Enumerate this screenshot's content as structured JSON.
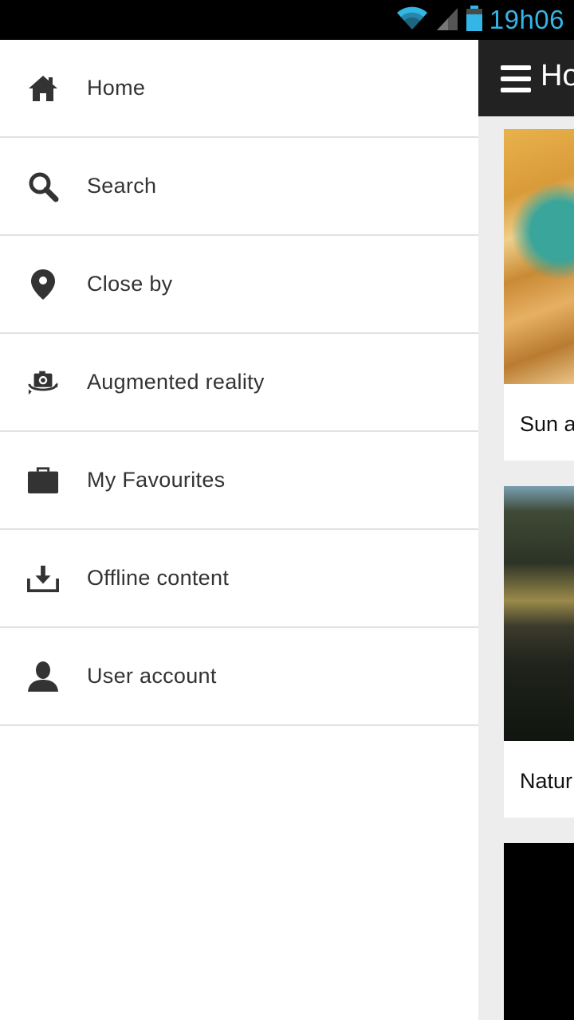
{
  "status_bar": {
    "time": "19h06",
    "icons": [
      "wifi-icon",
      "signal-icon",
      "battery-icon"
    ],
    "accent_color": "#33b5e5"
  },
  "drawer": {
    "items": [
      {
        "label": "Home",
        "icon": "home-icon"
      },
      {
        "label": "Search",
        "icon": "search-icon"
      },
      {
        "label": "Close by",
        "icon": "location-pin-icon"
      },
      {
        "label": "Augmented reality",
        "icon": "ar-camera-icon"
      },
      {
        "label": "My Favourites",
        "icon": "briefcase-icon"
      },
      {
        "label": "Offline content",
        "icon": "download-icon"
      },
      {
        "label": "User account",
        "icon": "user-icon"
      }
    ]
  },
  "app": {
    "title": "Ho",
    "cards": [
      {
        "caption": "Sun a"
      },
      {
        "caption": "Natur"
      }
    ]
  }
}
